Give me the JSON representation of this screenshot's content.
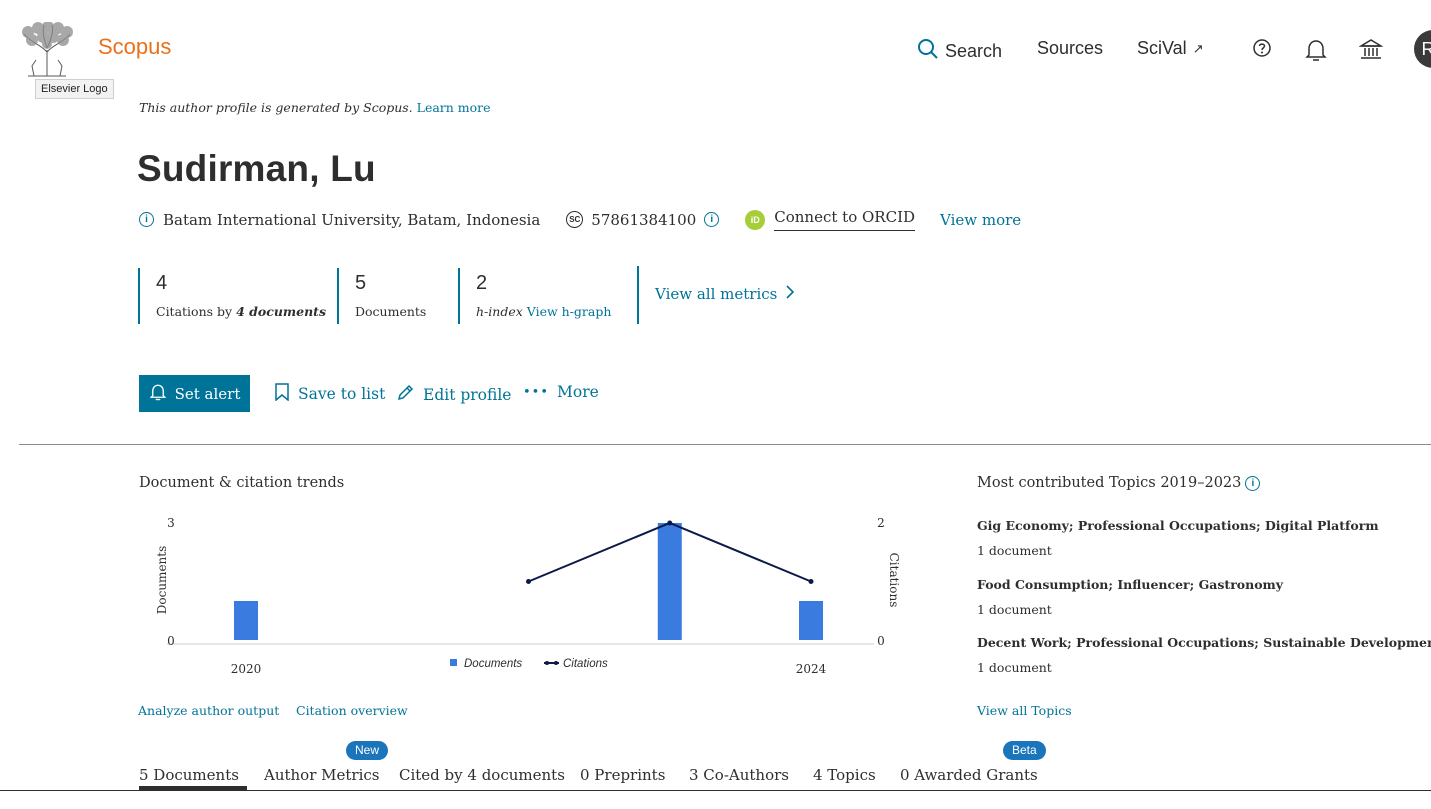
{
  "header": {
    "brand": "Scopus",
    "logo_tooltip": "Elsevier Logo",
    "nav": {
      "search": "Search",
      "sources": "Sources",
      "scival": "SciVal",
      "scival_arrow": "↗"
    },
    "avatar_letter": "R"
  },
  "notice": {
    "text": "This author profile is generated by Scopus.",
    "link": "Learn more"
  },
  "author": {
    "name": "Sudirman, Lu",
    "affiliation": "Batam International University, Batam, Indonesia",
    "scopus_id": "57861384100",
    "scopus_id_badge": "SC",
    "orcid_badge": "iD",
    "orcid_label": "Connect to ORCID",
    "view_more": "View more"
  },
  "metrics": {
    "citations_value": "4",
    "citations_label": "Citations by",
    "citations_docs": "4 documents",
    "documents_value": "5",
    "documents_label": "Documents",
    "hindex_value": "2",
    "hindex_label": "h-index",
    "hgraph_link": "View h-graph",
    "view_all": "View all metrics"
  },
  "actions": {
    "set_alert": "Set alert",
    "save_to_list": "Save to list",
    "edit_profile": "Edit profile",
    "more_dots": "•••",
    "more": "More"
  },
  "trends": {
    "title": "Document & citation trends",
    "analyze_link": "Analyze author output",
    "citation_link": "Citation overview"
  },
  "chart_data": {
    "type": "bar",
    "x": [
      2020,
      2021,
      2022,
      2023,
      2024
    ],
    "x_tick_labels": [
      "2020",
      "2024"
    ],
    "series": [
      {
        "name": "Documents",
        "kind": "bar",
        "axis": "left",
        "values": [
          1,
          0,
          0,
          3,
          1
        ]
      },
      {
        "name": "Citations",
        "kind": "line",
        "axis": "right",
        "values": [
          null,
          null,
          1,
          2,
          1
        ]
      }
    ],
    "ylabel": "Documents",
    "y2label": "Citations",
    "ylim": [
      0,
      3
    ],
    "y2lim": [
      0,
      2
    ],
    "y_tick_labels": [
      "0",
      "3"
    ],
    "y2_tick_labels": [
      "0",
      "2"
    ],
    "legend": "bottom-center",
    "colors": {
      "Documents": "#3a7be0",
      "Citations": "#0c1a4a"
    }
  },
  "topics": {
    "title": "Most contributed Topics 2019–2023",
    "items": [
      {
        "title": "Gig Economy; Professional Occupations; Digital Platform",
        "count": "1 document"
      },
      {
        "title": "Food Consumption; Influencer; Gastronomy",
        "count": "1 document"
      },
      {
        "title": "Decent Work; Professional Occupations; Sustainable Development Goals",
        "count": "1 document"
      }
    ],
    "view_all": "View all Topics"
  },
  "tabs": [
    {
      "label": "5 Documents",
      "active": true
    },
    {
      "label": "Author Metrics",
      "badge": "New"
    },
    {
      "label": "Cited by 4 documents"
    },
    {
      "label": "0 Preprints"
    },
    {
      "label": "3 Co-Authors"
    },
    {
      "label": "4 Topics"
    },
    {
      "label": "0 Awarded Grants",
      "badge": "Beta"
    }
  ],
  "colors": {
    "accent": "#007398",
    "brand": "#e9711c",
    "orcid": "#a6ce39",
    "badge": "#1b75bb"
  }
}
